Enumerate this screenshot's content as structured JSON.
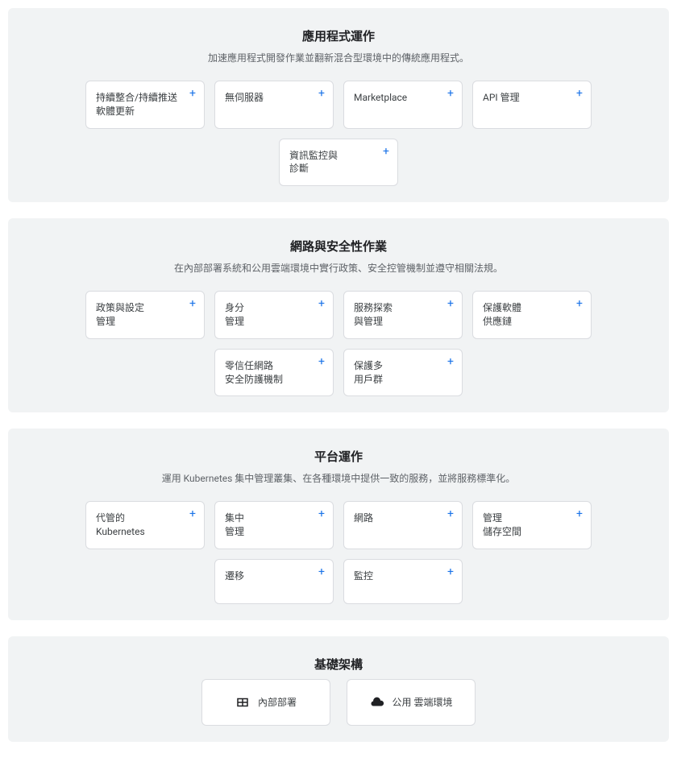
{
  "sections": [
    {
      "title": "應用程式運作",
      "desc": "加速應用程式開發作業並翻新混合型環境中的傳統應用程式。",
      "cards": [
        {
          "label": "持續整合/持續推送軟體更新"
        },
        {
          "label": "無伺服器"
        },
        {
          "label": "Marketplace"
        },
        {
          "label": "API 管理"
        },
        {
          "label": "資訊監控與\n診斷"
        }
      ]
    },
    {
      "title": "網路與安全性作業",
      "desc": "在內部部署系統和公用雲端環境中實行政策、安全控管機制並遵守相關法規。",
      "cards": [
        {
          "label": "政策與設定\n管理"
        },
        {
          "label": "身分\n管理"
        },
        {
          "label": "服務探索\n與管理"
        },
        {
          "label": "保護軟體\n供應鏈"
        },
        {
          "label": "零信任網路\n安全防護機制"
        },
        {
          "label": "保護多\n用戶群"
        }
      ]
    },
    {
      "title": "平台運作",
      "desc": "運用 Kubernetes 集中管理叢集、在各種環境中提供一致的服務，並將服務標準化。",
      "cards": [
        {
          "label": "代管的\nKubernetes"
        },
        {
          "label": "集中\n管理"
        },
        {
          "label": "網路"
        },
        {
          "label": "管理\n儲存空間"
        },
        {
          "label": "遷移"
        },
        {
          "label": "監控"
        }
      ]
    }
  ],
  "infra": {
    "title": "基礎架構",
    "items": [
      {
        "icon": "grid",
        "label": "內部部署"
      },
      {
        "icon": "cloud",
        "label": "公用   雲端環境"
      }
    ]
  }
}
